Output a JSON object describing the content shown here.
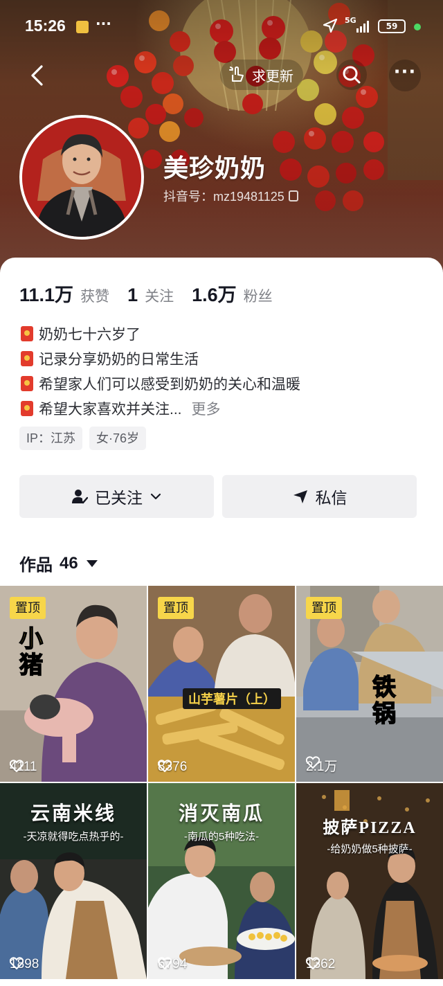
{
  "status_bar": {
    "time": "15:26",
    "dots": "···",
    "network": "5G",
    "battery": "59"
  },
  "header": {
    "update_label": "求更新"
  },
  "profile": {
    "name": "美珍奶奶",
    "id_text": "抖音号：mz19481125"
  },
  "stats": [
    {
      "value": "11.1万",
      "label": "获赞"
    },
    {
      "value": "1",
      "label": "关注"
    },
    {
      "value": "1.6万",
      "label": "粉丝"
    }
  ],
  "bio": {
    "lines": [
      "奶奶七十六岁了",
      "记录分享奶奶的日常生活",
      "希望家人们可以感受到奶奶的关心和温暖",
      "希望大家喜欢并关注..."
    ],
    "more": "更多"
  },
  "tags": [
    "IP：江苏",
    "女·76岁"
  ],
  "actions": {
    "followed": "已关注",
    "message": "私信"
  },
  "works": {
    "label": "作品",
    "count": "46"
  },
  "videos": [
    {
      "pinned": "置顶",
      "likes": "4111",
      "overlay": "小猪"
    },
    {
      "pinned": "置顶",
      "likes": "8376",
      "overlay": "山芋薯片（上）"
    },
    {
      "pinned": "置顶",
      "likes": "2.1万",
      "overlay": "铁锅"
    },
    {
      "likes": "1898",
      "title": "云南米线",
      "subtitle": "-天凉就得吃点热乎的-"
    },
    {
      "likes": "6794",
      "title": "消灭南瓜",
      "subtitle": "-南瓜的5种吃法-"
    },
    {
      "likes": "1362",
      "title": "披萨PIZZA",
      "subtitle": "-给奶奶做5种披萨-"
    }
  ]
}
